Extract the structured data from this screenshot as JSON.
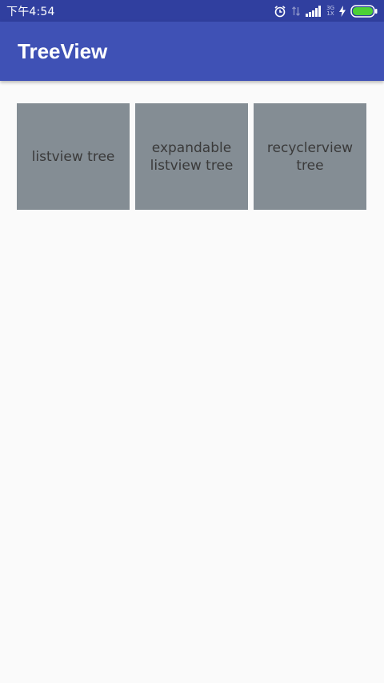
{
  "status_bar": {
    "time": "下午4:54",
    "icons": [
      "alarm-icon",
      "data-transfer-icon",
      "signal-icon",
      "network-type-icon",
      "charging-icon",
      "battery-icon"
    ],
    "network_type": [
      "3G",
      "1X"
    ],
    "colors": {
      "background": "#303f9f",
      "battery_fill": "#4cd137"
    }
  },
  "app_bar": {
    "title": "TreeView",
    "color": "#3f51b5"
  },
  "tiles": [
    {
      "label": "listview tree"
    },
    {
      "label": "expandable\nlistview tree"
    },
    {
      "label": "recyclerview tree"
    }
  ],
  "colors": {
    "tile_background": "#848d94",
    "page_background": "#fafafa"
  }
}
